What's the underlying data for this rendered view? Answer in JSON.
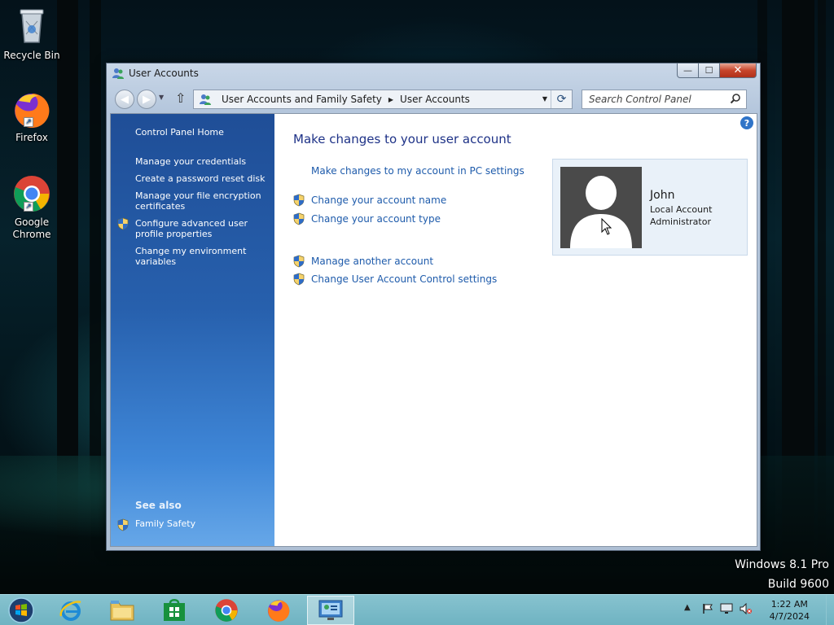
{
  "desktop": {
    "icons": [
      {
        "label": "Recycle Bin",
        "icon": "recycle-bin-icon"
      },
      {
        "label": "Firefox",
        "icon": "firefox-icon"
      },
      {
        "label": "Google Chrome",
        "icon": "chrome-icon"
      }
    ],
    "watermark": {
      "line1": "Windows 8.1 Pro",
      "line2": "Build 9600"
    }
  },
  "window": {
    "title": "User Accounts",
    "controls": {
      "minimize": "—",
      "maximize": "☐",
      "close": "✕"
    },
    "address": {
      "crumbs": [
        "User Accounts and Family Safety",
        "User Accounts"
      ]
    },
    "search": {
      "placeholder": "Search Control Panel"
    }
  },
  "sidebar": {
    "home": "Control Panel Home",
    "links": [
      {
        "label": "Manage your credentials",
        "shield": false
      },
      {
        "label": "Create a password reset disk",
        "shield": false
      },
      {
        "label": "Manage your file encryption certificates",
        "shield": false
      },
      {
        "label": "Configure advanced user profile properties",
        "shield": true
      },
      {
        "label": "Change my environment variables",
        "shield": false
      }
    ],
    "see_also": {
      "heading": "See also",
      "links": [
        {
          "label": "Family Safety",
          "shield": true
        }
      ]
    }
  },
  "main": {
    "title": "Make changes to your user account",
    "pc_settings_link": "Make changes to my account in PC settings",
    "links": [
      {
        "label": "Change your account name",
        "shield": true
      },
      {
        "label": "Change your account type",
        "shield": true
      },
      {
        "label": "Manage another account",
        "shield": true
      },
      {
        "label": "Change User Account Control settings",
        "shield": true
      }
    ],
    "account": {
      "name": "John",
      "type": "Local Account",
      "role": "Administrator"
    },
    "help": "?"
  },
  "taskbar": {
    "apps": [
      "start-icon",
      "internet-explorer-icon",
      "file-explorer-icon",
      "store-icon",
      "chrome-icon",
      "firefox-icon",
      "control-panel-icon"
    ],
    "clock": {
      "time": "1:22 AM",
      "date": "4/7/2024"
    }
  },
  "colors": {
    "link": "#1e5bab",
    "title": "#1e3287",
    "sidebar_top": "#1f4e97",
    "sidebar_bottom": "#66a7e8",
    "taskbar": "#7dbccb",
    "close_button": "#c7452b"
  }
}
